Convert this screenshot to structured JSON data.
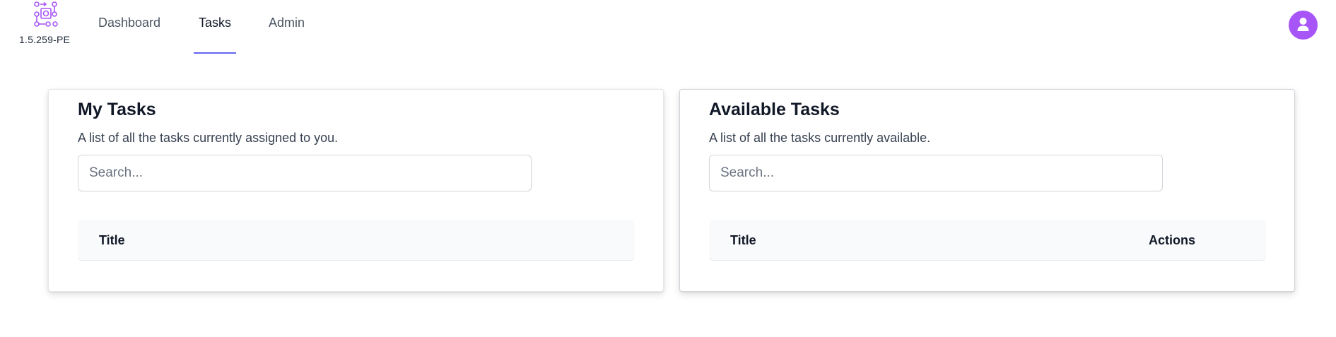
{
  "app": {
    "version": "1.5.259-PE",
    "accent_color": "#6366f1",
    "logo_color": "#a855f7",
    "avatar_color": "#a855f7",
    "logo_icon": "workflow-logo-icon",
    "avatar_icon": "user-icon"
  },
  "nav": {
    "items": [
      {
        "label": "Dashboard",
        "active": false
      },
      {
        "label": "Tasks",
        "active": true
      },
      {
        "label": "Admin",
        "active": false
      }
    ]
  },
  "my_tasks": {
    "title": "My Tasks",
    "subtitle": "A list of all the tasks currently assigned to you.",
    "search": {
      "placeholder": "Search...",
      "value": ""
    },
    "columns": [
      "Title"
    ],
    "rows": []
  },
  "available_tasks": {
    "title": "Available Tasks",
    "subtitle": "A list of all the tasks currently available.",
    "search": {
      "placeholder": "Search...",
      "value": ""
    },
    "columns": [
      "Title",
      "Actions"
    ],
    "rows": []
  }
}
